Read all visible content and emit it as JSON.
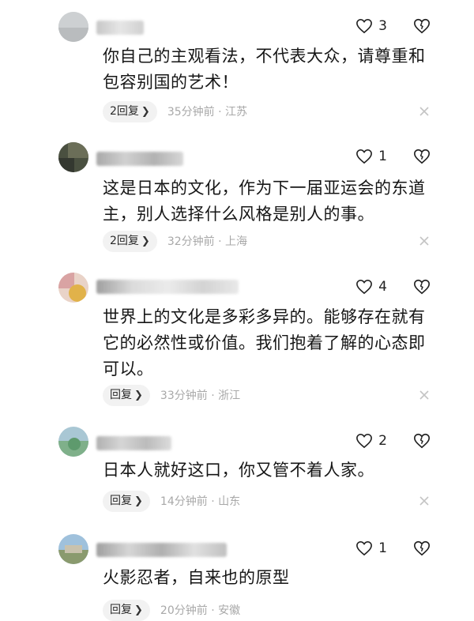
{
  "comments": [
    {
      "text": "你自己的主观看法，不代表大众，请尊重和包容别国的艺术！",
      "likes": "3",
      "reply_label": "2回复",
      "time": "35分钟前",
      "separator": "·",
      "location": "江苏"
    },
    {
      "text": "这是日本的文化，作为下一届亚运会的东道主，别人选择什么风格是别人的事。",
      "likes": "1",
      "reply_label": "2回复",
      "time": "32分钟前",
      "separator": "·",
      "location": "上海"
    },
    {
      "text": "世界上的文化是多彩多异的。能够存在就有它的必然性或价值。我们抱着了解的心态即可以。",
      "likes": "4",
      "reply_label": "回复",
      "time": "33分钟前",
      "separator": "·",
      "location": "浙江"
    },
    {
      "text": "日本人就好这口，你又管不着人家。",
      "likes": "2",
      "reply_label": "回复",
      "time": "14分钟前",
      "separator": "·",
      "location": "山东"
    },
    {
      "text": "火影忍者，自来也的原型",
      "likes": "1",
      "reply_label": "回复",
      "time": "20分钟前",
      "separator": "·",
      "location": "安徽"
    }
  ],
  "icons": {
    "like": "heart-outline-icon",
    "dislike": "broken-heart-icon",
    "reply": "chevron-right-icon",
    "close": "close-icon"
  },
  "colors": {
    "text": "#161616",
    "meta": "#a8a8a8",
    "reply_bg": "#f2f2f2"
  }
}
